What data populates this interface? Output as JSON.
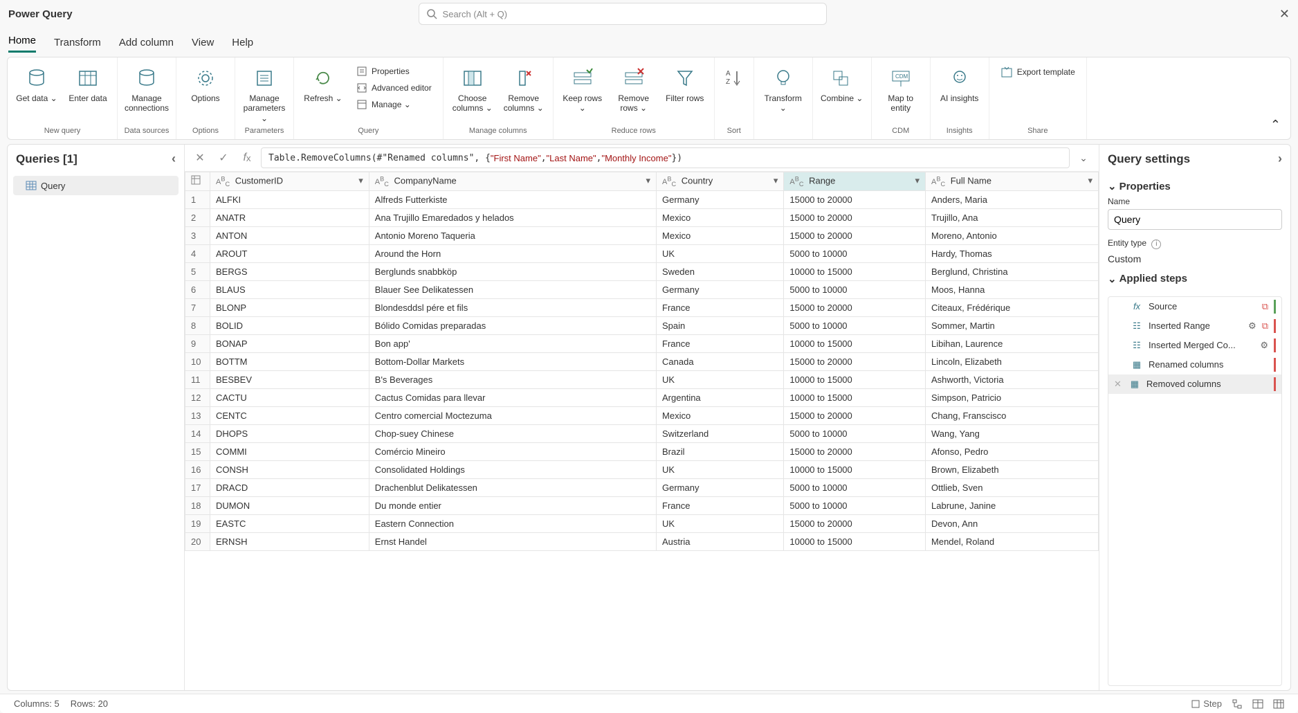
{
  "title": "Power Query",
  "search_placeholder": "Search (Alt + Q)",
  "tabs": [
    "Home",
    "Transform",
    "Add column",
    "View",
    "Help"
  ],
  "active_tab": 0,
  "ribbon": {
    "groups": [
      {
        "label": "New query",
        "items": [
          {
            "label": "Get data",
            "dd": true
          },
          {
            "label": "Enter data"
          }
        ]
      },
      {
        "label": "Data sources",
        "items": [
          {
            "label": "Manage connections"
          }
        ]
      },
      {
        "label": "Options",
        "items": [
          {
            "label": "Options"
          }
        ]
      },
      {
        "label": "Parameters",
        "items": [
          {
            "label": "Manage parameters",
            "dd": true
          }
        ]
      },
      {
        "label": "Query",
        "items": [
          {
            "label": "Refresh",
            "dd": true
          }
        ],
        "small": [
          {
            "label": "Properties"
          },
          {
            "label": "Advanced editor"
          },
          {
            "label": "Manage",
            "dd": true
          }
        ]
      },
      {
        "label": "Manage columns",
        "items": [
          {
            "label": "Choose columns",
            "dd": true
          },
          {
            "label": "Remove columns",
            "dd": true
          }
        ]
      },
      {
        "label": "Reduce rows",
        "items": [
          {
            "label": "Keep rows",
            "dd": true
          },
          {
            "label": "Remove rows",
            "dd": true
          },
          {
            "label": "Filter rows"
          }
        ]
      },
      {
        "label": "Sort",
        "items": [
          {
            "label": ""
          }
        ]
      },
      {
        "label": "",
        "items": [
          {
            "label": "Transform",
            "dd": true
          }
        ]
      },
      {
        "label": "",
        "items": [
          {
            "label": "Combine",
            "dd": true
          }
        ]
      },
      {
        "label": "CDM",
        "items": [
          {
            "label": "Map to entity"
          }
        ]
      },
      {
        "label": "Insights",
        "items": [
          {
            "label": "AI insights"
          }
        ]
      },
      {
        "label": "Share",
        "small": [
          {
            "label": "Export template"
          }
        ]
      }
    ]
  },
  "queries_label": "Queries [1]",
  "query_item": "Query",
  "formula": {
    "prefix": "Table.RemoveColumns(#\"Renamed columns\", {",
    "args": [
      "\"First Name\"",
      "\"Last Name\"",
      "\"Monthly Income\""
    ],
    "suffix": "})"
  },
  "columns": [
    {
      "name": "CustomerID",
      "selected": false
    },
    {
      "name": "CompanyName",
      "selected": false
    },
    {
      "name": "Country",
      "selected": false
    },
    {
      "name": "Range",
      "selected": true
    },
    {
      "name": "Full Name",
      "selected": false
    }
  ],
  "rows": [
    [
      "ALFKI",
      "Alfreds Futterkiste",
      "Germany",
      "15000 to 20000",
      "Anders, Maria"
    ],
    [
      "ANATR",
      "Ana Trujillo Emaredados y helados",
      "Mexico",
      "15000 to 20000",
      "Trujillo, Ana"
    ],
    [
      "ANTON",
      "Antonio Moreno Taqueria",
      "Mexico",
      "15000 to 20000",
      "Moreno, Antonio"
    ],
    [
      "AROUT",
      "Around the Horn",
      "UK",
      "5000 to 10000",
      "Hardy, Thomas"
    ],
    [
      "BERGS",
      "Berglunds snabbköp",
      "Sweden",
      "10000 to 15000",
      "Berglund, Christina"
    ],
    [
      "BLAUS",
      "Blauer See Delikatessen",
      "Germany",
      "5000 to 10000",
      "Moos, Hanna"
    ],
    [
      "BLONP",
      "Blondesddsl pére et fils",
      "France",
      "15000 to 20000",
      "Citeaux, Frédérique"
    ],
    [
      "BOLID",
      "Bólido Comidas preparadas",
      "Spain",
      "5000 to 10000",
      "Sommer, Martin"
    ],
    [
      "BONAP",
      "Bon app'",
      "France",
      "10000 to 15000",
      "Libihan, Laurence"
    ],
    [
      "BOTTM",
      "Bottom-Dollar Markets",
      "Canada",
      "15000 to 20000",
      "Lincoln, Elizabeth"
    ],
    [
      "BESBEV",
      "B's Beverages",
      "UK",
      "10000 to 15000",
      "Ashworth, Victoria"
    ],
    [
      "CACTU",
      "Cactus Comidas para llevar",
      "Argentina",
      "10000 to 15000",
      "Simpson, Patricio"
    ],
    [
      "CENTC",
      "Centro comercial Moctezuma",
      "Mexico",
      "15000 to 20000",
      "Chang, Franscisco"
    ],
    [
      "DHOPS",
      "Chop-suey Chinese",
      "Switzerland",
      "5000 to 10000",
      "Wang, Yang"
    ],
    [
      "COMMI",
      "Comércio Mineiro",
      "Brazil",
      "15000 to 20000",
      "Afonso, Pedro"
    ],
    [
      "CONSH",
      "Consolidated Holdings",
      "UK",
      "10000 to 15000",
      "Brown, Elizabeth"
    ],
    [
      "DRACD",
      "Drachenblut Delikatessen",
      "Germany",
      "5000 to 10000",
      "Ottlieb, Sven"
    ],
    [
      "DUMON",
      "Du monde entier",
      "France",
      "5000 to 10000",
      "Labrune, Janine"
    ],
    [
      "EASTC",
      "Eastern Connection",
      "UK",
      "15000 to 20000",
      "Devon, Ann"
    ],
    [
      "ERNSH",
      "Ernst Handel",
      "Austria",
      "10000 to 15000",
      "Mendel, Roland"
    ]
  ],
  "query_settings": {
    "title": "Query settings",
    "properties_label": "Properties",
    "name_label": "Name",
    "name_value": "Query",
    "entity_type_label": "Entity type",
    "entity_type_value": "Custom",
    "applied_steps_label": "Applied steps"
  },
  "steps": [
    {
      "label": "Source",
      "gear": false,
      "extra": true,
      "bar": "green"
    },
    {
      "label": "Inserted Range",
      "gear": true,
      "extra": true,
      "bar": "red"
    },
    {
      "label": "Inserted Merged Co...",
      "gear": true,
      "extra": false,
      "bar": "red"
    },
    {
      "label": "Renamed columns",
      "gear": false,
      "extra": false,
      "bar": "red"
    },
    {
      "label": "Removed columns",
      "gear": false,
      "extra": false,
      "bar": "red",
      "selected": true,
      "del": true
    }
  ],
  "status": {
    "cols": "Columns: 5",
    "rows": "Rows: 20",
    "step": "Step"
  }
}
